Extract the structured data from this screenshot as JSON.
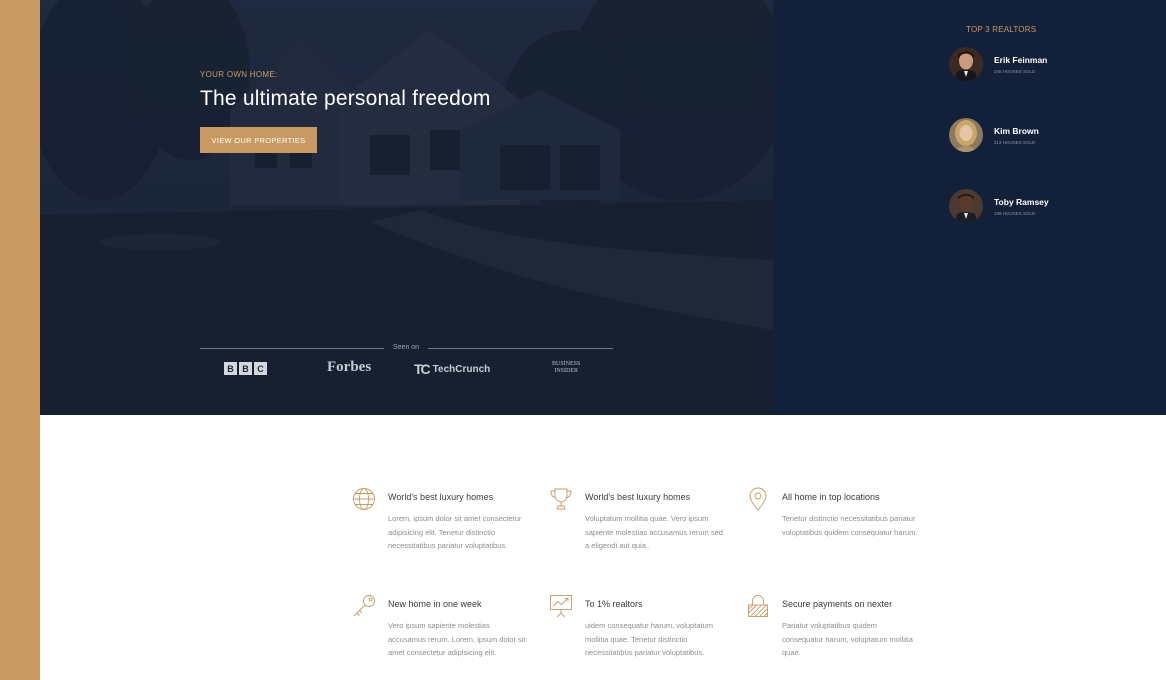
{
  "brand": {
    "accent": "#c89a62",
    "navy": "#13203a"
  },
  "hero": {
    "kicker": "YOUR OWN HOME:",
    "headline": "The ultimate personal freedom",
    "cta_label": "VIEW OUR PROPERTIES",
    "seen_on_label": "Seen on",
    "press_logos": [
      {
        "name": "BBC",
        "letters": [
          "B",
          "B",
          "C"
        ]
      },
      {
        "name": "Forbes"
      },
      {
        "name": "TechCrunch",
        "mark": "TC"
      },
      {
        "name": "Business Insider",
        "line1": "BUSINESS",
        "line2": "INSIDER"
      }
    ]
  },
  "realtors": {
    "title": "TOP 3 REALTORS",
    "items": [
      {
        "name": "Erik Feinman",
        "sold": "245 HOUSES SOLD"
      },
      {
        "name": "Kim Brown",
        "sold": "212 HOUSES SOLD"
      },
      {
        "name": "Toby Ramsey",
        "sold": "198 HOUSES SOLD"
      }
    ]
  },
  "features": [
    {
      "icon": "globe-icon",
      "title": "World's best luxury homes",
      "text": "Lorem, ipsum dolor sit amet consectetur adipisicing elit. Tenetur distinctio necessitatibus pariatur voluptatibus."
    },
    {
      "icon": "trophy-icon",
      "title": "World's best luxury homes",
      "text": "Voluptatum mollitia quae. Vero ipsum sapiente molestias accusamus rerum sed a eligendi aut quia.."
    },
    {
      "icon": "map-pin-icon",
      "title": "All home in top locations",
      "text": "Tenetur distinctio necessitatibus pariatur voluptatibus quidem consequatur harum."
    },
    {
      "icon": "key-icon",
      "title": "New home in one week",
      "text": "Vero ipsum sapiente molestias accusamus rerum. Lorem, ipsum dolor sit amet consectetur adipisicing elit."
    },
    {
      "icon": "chart-presentation-icon",
      "title": "To 1% realtors",
      "text": "uidem consequatur harum, voluptatum mollitia quae. Tenetur distinctio necessitatibus pariatur voluptatibus."
    },
    {
      "icon": "lock-icon",
      "title": "Secure payments on nexter",
      "text": "Pariatur voluptatibus quidem consequatur harum, voluptatum mollitia quae."
    }
  ]
}
